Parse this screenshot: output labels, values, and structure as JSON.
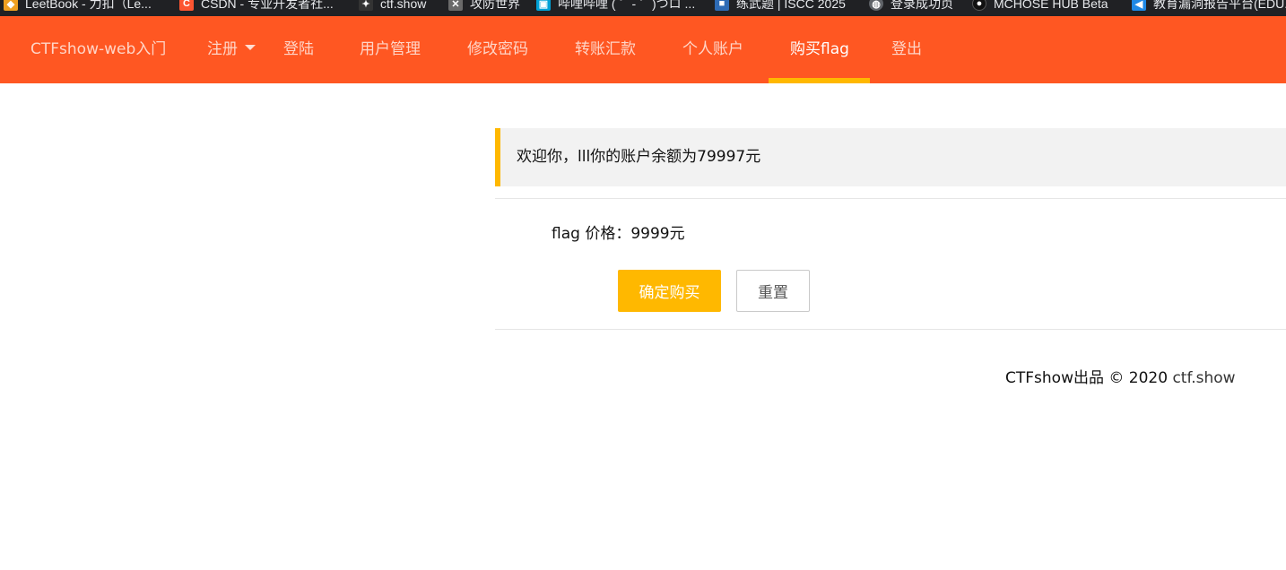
{
  "bookmarks": [
    {
      "label": "LeetBook - 力扣（Le...",
      "icon": "leetcode-icon",
      "color": "#f0a020"
    },
    {
      "label": "CSDN - 专业开发者社...",
      "icon": "csdn-icon",
      "color": "#fc5531"
    },
    {
      "label": "ctf.show",
      "icon": "ctfshow-icon",
      "color": "#333333"
    },
    {
      "label": "攻防世界",
      "icon": "adworld-icon",
      "color": "#6a6a6a"
    },
    {
      "label": "哔哩哔哩 ( ゜- ゜)つロ ...",
      "icon": "bilibili-icon",
      "color": "#00a1d6"
    },
    {
      "label": "练武题 | ISCC 2025",
      "icon": "iscc-icon",
      "color": "#2d6bb5"
    },
    {
      "label": "登录成功页",
      "icon": "globe-icon",
      "color": "#5f6368"
    },
    {
      "label": "MCHOSE HUB Beta",
      "icon": "mchose-icon",
      "color": "#111111"
    },
    {
      "label": "教育漏洞报告平台(EDU...",
      "icon": "edu-icon",
      "color": "#1e88e5"
    }
  ],
  "nav": {
    "brand": "CTFshow-web入门",
    "items": [
      {
        "label": "注册",
        "dropdown": true
      },
      {
        "label": "登陆"
      },
      {
        "label": "用户管理"
      },
      {
        "label": "修改密码"
      },
      {
        "label": "转账汇款"
      },
      {
        "label": "个人账户"
      },
      {
        "label": "购买flag",
        "active": true
      },
      {
        "label": "登出"
      }
    ]
  },
  "notice": {
    "text": "欢迎你，lll你的账户余额为79997元"
  },
  "form": {
    "price_text": "flag 价格：9999元",
    "submit_label": "确定购买",
    "reset_label": "重置"
  },
  "footer": {
    "prefix": "CTFshow出品 © 2020 ",
    "link": "ctf.show"
  },
  "colors": {
    "nav_bg": "#ff5722",
    "accent": "#ffb800",
    "notice_bg": "#f2f2f2"
  }
}
